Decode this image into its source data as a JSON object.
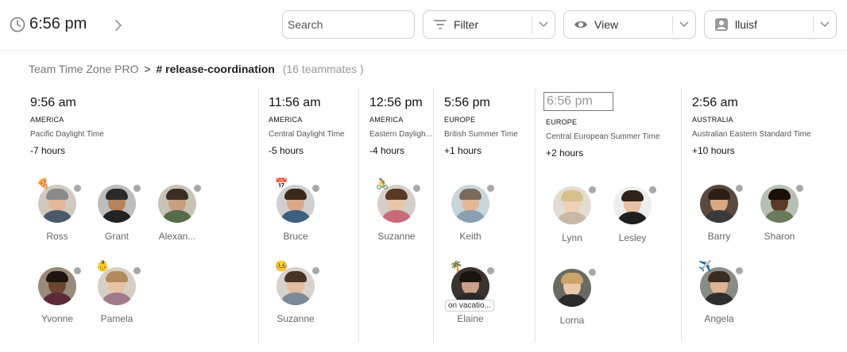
{
  "header": {
    "current_time": "6:56 pm",
    "search_placeholder": "Search",
    "filter_label": "Filter",
    "view_label": "View",
    "user_label": "lluisf"
  },
  "breadcrumb": {
    "app": "Team Time Zone PRO",
    "separator": ">",
    "channel": "# release-coordination",
    "count": "(16 teammates )"
  },
  "colors": {
    "status_dot": "#a8a8a8",
    "divider": "#e3e3e3"
  },
  "zones": [
    {
      "time": "9:56 am",
      "region": "AMERICA",
      "tz": "Pacific Daylight Time",
      "offset": "-7 hours",
      "people": [
        {
          "name": "Ross",
          "emoji": "🍕"
        },
        {
          "name": "Grant",
          "emoji": ""
        },
        {
          "name": "Alexan...",
          "emoji": ""
        },
        {
          "name": "Yvonne",
          "emoji": ""
        },
        {
          "name": "Pamela",
          "emoji": "👶"
        }
      ]
    },
    {
      "time": "11:56 am",
      "region": "AMERICA",
      "tz": "Central Daylight Time",
      "offset": "-5 hours",
      "people": [
        {
          "name": "Bruce",
          "emoji": "📅"
        },
        {
          "name": "Suzanne",
          "emoji": "🤒"
        }
      ]
    },
    {
      "time": "12:56 pm",
      "region": "AMERICA",
      "tz": "Eastern Dayligh...",
      "offset": "-4 hours",
      "people": [
        {
          "name": "Suzanne",
          "emoji": "🚴"
        }
      ]
    },
    {
      "time": "5:56 pm",
      "region": "EUROPE",
      "tz": "British Summer Time",
      "offset": "+1 hours",
      "people": [
        {
          "name": "Keith",
          "emoji": ""
        },
        {
          "name": "Elaine",
          "emoji": "🌴",
          "tag": "on vacatio..."
        }
      ]
    },
    {
      "time": "6:56 pm",
      "region": "EUROPE",
      "tz": "Central European Summer Time",
      "offset": "+2 hours",
      "people": [
        {
          "name": "Lynn",
          "emoji": ""
        },
        {
          "name": "Lesley",
          "emoji": ""
        },
        {
          "name": "Lorna",
          "emoji": ""
        }
      ]
    },
    {
      "time": "2:56 am",
      "region": "AUSTRALIA",
      "tz": "Australian Eastern Standard Time",
      "offset": "+10 hours",
      "people": [
        {
          "name": "Barry",
          "emoji": ""
        },
        {
          "name": "Sharon",
          "emoji": ""
        },
        {
          "name": "Angela",
          "emoji": "✈️"
        }
      ]
    }
  ]
}
